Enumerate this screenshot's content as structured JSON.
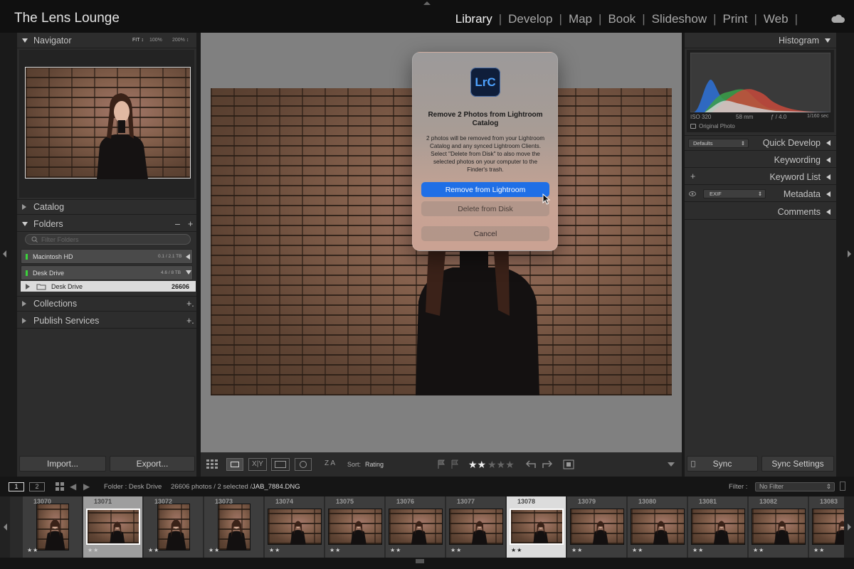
{
  "app": {
    "identity_plate": "The Lens Lounge",
    "modules": [
      "Library",
      "Develop",
      "Map",
      "Book",
      "Slideshow",
      "Print",
      "Web"
    ],
    "active_module": "Library"
  },
  "left": {
    "navigator": {
      "title": "Navigator",
      "zoom": [
        "FIT ↕",
        "100%",
        "200% ↕"
      ]
    },
    "catalog": {
      "title": "Catalog"
    },
    "folders": {
      "title": "Folders",
      "filter_placeholder": "Filter Folders",
      "volumes": [
        {
          "name": "Macintosh HD",
          "usage": "0.1 / 2.1 TB"
        },
        {
          "name": "Desk Drive",
          "usage": "4.6 / 8 TB"
        }
      ],
      "folder": {
        "name": "Desk Drive",
        "count": "26606"
      }
    },
    "collections": {
      "title": "Collections"
    },
    "publish": {
      "title": "Publish Services"
    },
    "import_label": "Import...",
    "export_label": "Export..."
  },
  "right": {
    "histogram": {
      "title": "Histogram",
      "iso": "ISO 320",
      "focal": "58 mm",
      "aperture": "ƒ / 4.0",
      "shutter": "1/160 sec",
      "original_photo": "Original Photo"
    },
    "quick_develop": {
      "title": "Quick Develop",
      "preset": "Defaults"
    },
    "keywording": {
      "title": "Keywording"
    },
    "keyword_list": {
      "title": "Keyword List"
    },
    "metadata": {
      "title": "Metadata",
      "preset": "EXIF"
    },
    "comments": {
      "title": "Comments"
    },
    "sync_label": "Sync",
    "sync_settings_label": "Sync Settings"
  },
  "dialog": {
    "logo": "LrC",
    "title": "Remove 2 Photos from Lightroom Catalog",
    "body": "2 photos will be removed from your Lightroom Catalog and any synced Lightroom Clients. Select \"Delete from Disk\" to also move the selected photos on your computer to the Finder's trash.",
    "primary": "Remove from Lightroom",
    "secondary": "Delete from Disk",
    "cancel": "Cancel"
  },
  "toolbar": {
    "sort_label": "Sort:",
    "sort_value": "Rating",
    "rating_filled": "★★",
    "rating_empty": "★★★",
    "az": "Z A"
  },
  "filmbar": {
    "page1": "1",
    "page2": "2",
    "source": "Folder : Desk Drive",
    "count": "26606 photos / 2 selected /",
    "filename": "JAB_7884.DNG",
    "filter_label": "Filter :",
    "filter_value": "No Filter"
  },
  "filmstrip": [
    {
      "num": "13070",
      "stars": "★★",
      "orient": "portrait"
    },
    {
      "num": "13071",
      "stars": "★★",
      "orient": "landscape",
      "state": "selected"
    },
    {
      "num": "13072",
      "stars": "★★",
      "orient": "portrait"
    },
    {
      "num": "13073",
      "stars": "★★",
      "orient": "portrait"
    },
    {
      "num": "13074",
      "stars": "★★",
      "orient": "landscape"
    },
    {
      "num": "13075",
      "stars": "★★",
      "orient": "landscape"
    },
    {
      "num": "13076",
      "stars": "★★",
      "orient": "landscape"
    },
    {
      "num": "13077",
      "stars": "★★",
      "orient": "landscape"
    },
    {
      "num": "13078",
      "stars": "★★",
      "orient": "landscape",
      "state": "selected"
    },
    {
      "num": "13079",
      "stars": "★★",
      "orient": "landscape"
    },
    {
      "num": "13080",
      "stars": "★★",
      "orient": "landscape"
    },
    {
      "num": "13081",
      "stars": "★★",
      "orient": "landscape"
    },
    {
      "num": "13082",
      "stars": "★★",
      "orient": "landscape"
    },
    {
      "num": "13083",
      "stars": "★★",
      "orient": "landscape"
    }
  ],
  "colors": {
    "accent": "#1f6fe6",
    "lrc_logo_bg": "#0f1e3a",
    "lrc_logo_text": "#4fa3ff"
  }
}
